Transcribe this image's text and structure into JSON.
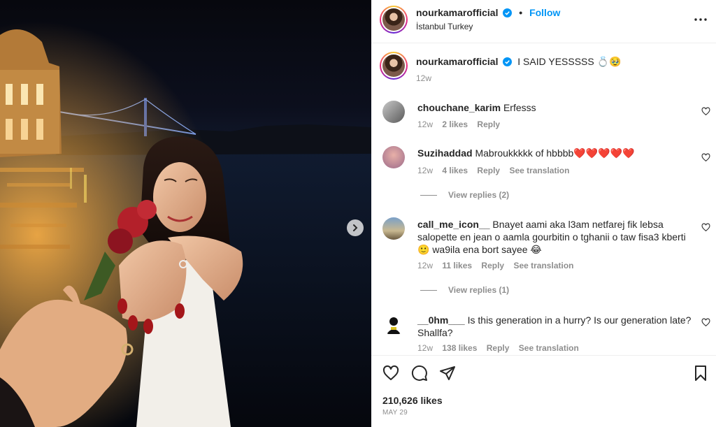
{
  "post": {
    "username": "nourkamarofficial",
    "follow_label": "Follow",
    "location": "İstanbul Turkey",
    "separator": "•"
  },
  "caption": {
    "username": "nourkamarofficial",
    "text": "I SAID YESSSSS 💍🥹",
    "time": "12w"
  },
  "comments": [
    {
      "username": "chouchane_karim",
      "text": "Erfesss",
      "time": "12w",
      "likes": "2 likes",
      "reply": "Reply"
    },
    {
      "username": "Suzihaddad",
      "text": "Mabroukkkkk of hbbbb❤️❤️❤️❤️❤️",
      "time": "12w",
      "likes": "4 likes",
      "reply": "Reply",
      "translation": "See translation",
      "replies": "View replies (2)"
    },
    {
      "username": "call_me_icon__",
      "text": "Bnayet aami aka l3am netfarej fik lebsa salopette en jean o aamla gourbitin o tghanii o taw fisa3 kberti 🙂 wa9ila ena bort sayee 😂",
      "time": "12w",
      "likes": "11 likes",
      "reply": "Reply",
      "translation": "See translation",
      "replies": "View replies (1)"
    },
    {
      "username": "__0hm___",
      "text": "Is this generation in a hurry? Is our generation late? Shallfa?",
      "time": "12w",
      "likes": "138 likes",
      "reply": "Reply",
      "translation": "See translation"
    }
  ],
  "footer": {
    "likes": "210,626 likes",
    "date": "MAY 29"
  },
  "colors": {
    "accent": "#0095f6",
    "verified": "#0095f6",
    "muted": "#8e8e8e",
    "text": "#262626"
  },
  "icons": [
    "verified-badge-icon",
    "more-options-icon",
    "heart-icon",
    "comment-icon",
    "share-icon",
    "bookmark-icon",
    "next-arrow-icon"
  ]
}
